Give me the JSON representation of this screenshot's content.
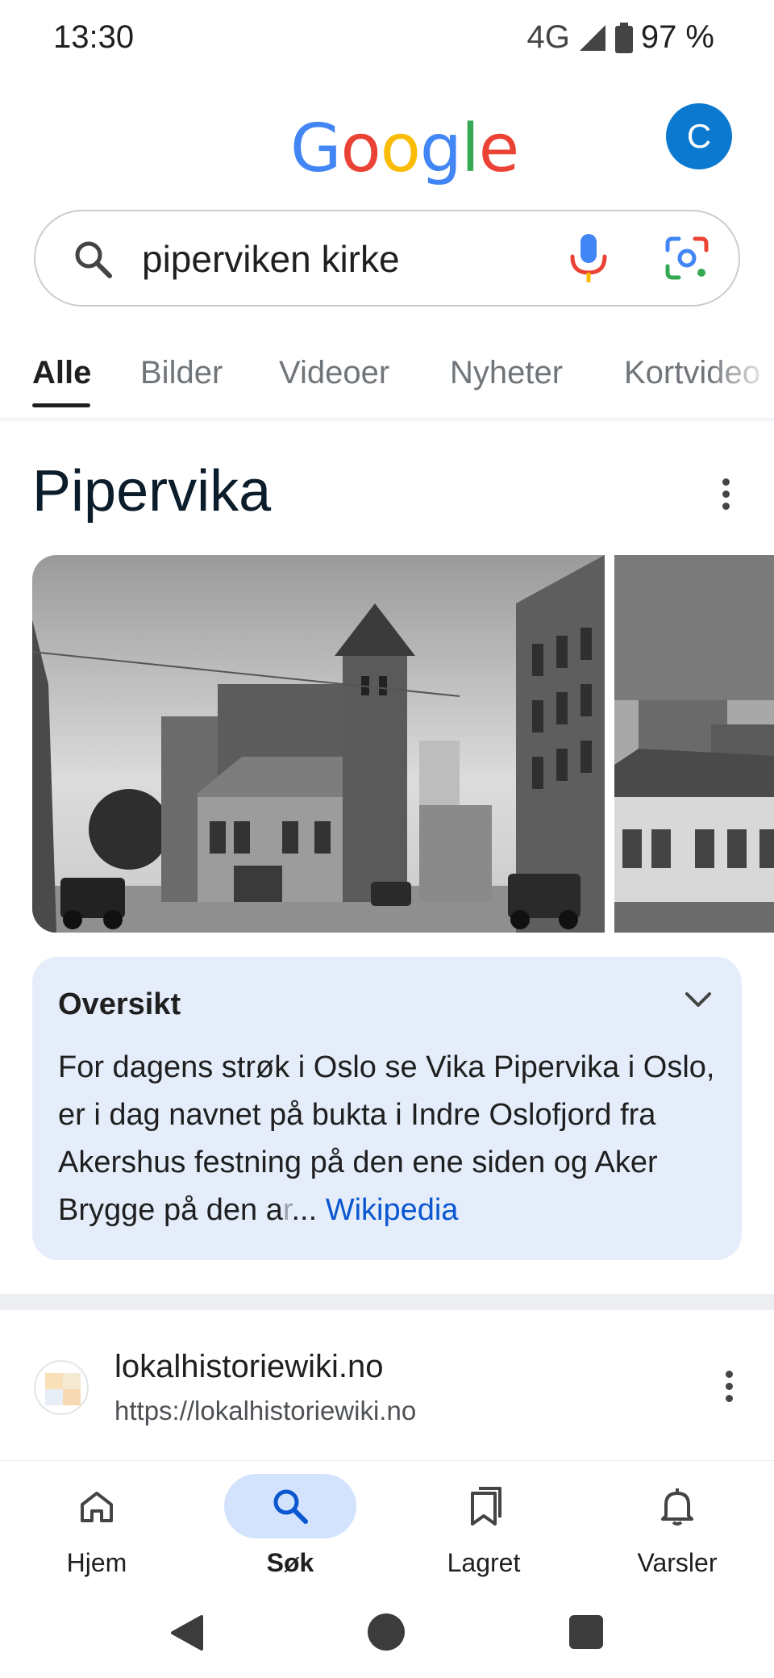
{
  "status_bar": {
    "time": "13:30",
    "network": "4G",
    "battery": "97 %"
  },
  "header": {
    "logo": {
      "letters": [
        "G",
        "o",
        "o",
        "g",
        "l",
        "e"
      ],
      "colors": [
        "#4285F4",
        "#EA4335",
        "#FBBC05",
        "#4285F4",
        "#34A853",
        "#EA4335"
      ]
    },
    "avatar_letter": "C",
    "avatar_color": "#0B79D0"
  },
  "search": {
    "query": "piperviken kirke"
  },
  "tabs": [
    {
      "label": "Alle",
      "active": true
    },
    {
      "label": "Bilder",
      "active": false
    },
    {
      "label": "Videoer",
      "active": false
    },
    {
      "label": "Nyheter",
      "active": false
    },
    {
      "label": "Kortvideo",
      "active": false
    }
  ],
  "knowledge_panel": {
    "title": "Pipervika",
    "overview": {
      "heading": "Oversikt",
      "text_main": "For dagens strøk i Oslo se Vika Pipervika i Oslo, er i dag navnet på bukta i Indre Oslofjord fra Akershus festning på den ene siden og Aker Brygge på den a",
      "text_faded": "r",
      "ellipsis": "...",
      "source": "Wikipedia"
    }
  },
  "results": [
    {
      "site": "lokalhistoriewiki.no",
      "url": "https://lokalhistoriewiki.no"
    }
  ],
  "bottom_nav": [
    {
      "label": "Hjem",
      "icon": "home-icon",
      "active": false
    },
    {
      "label": "Søk",
      "icon": "search-icon",
      "active": true
    },
    {
      "label": "Lagret",
      "icon": "bookmarks-icon",
      "active": false
    },
    {
      "label": "Varsler",
      "icon": "bell-icon",
      "active": false
    }
  ],
  "colors": {
    "accent_blue": "#0B57D0",
    "overview_bg": "#E5EDFB",
    "nav_active_bg": "#D3E3FD"
  }
}
